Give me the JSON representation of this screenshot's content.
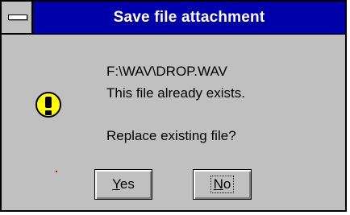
{
  "dialog": {
    "title": "Save file attachment",
    "file_path": "F:\\WAV\\DROP.WAV",
    "exists_message": "This file already exists.",
    "question": "Replace existing file?",
    "icon": "warning-exclamation-icon",
    "icon_color": "#ffff00",
    "title_bar_color": "#0000aa",
    "background_color": "#c0c0c0"
  },
  "buttons": {
    "yes_mnemonic": "Y",
    "yes_rest": "es",
    "no_mnemonic": "N",
    "no_rest": "o",
    "focused": "No"
  }
}
